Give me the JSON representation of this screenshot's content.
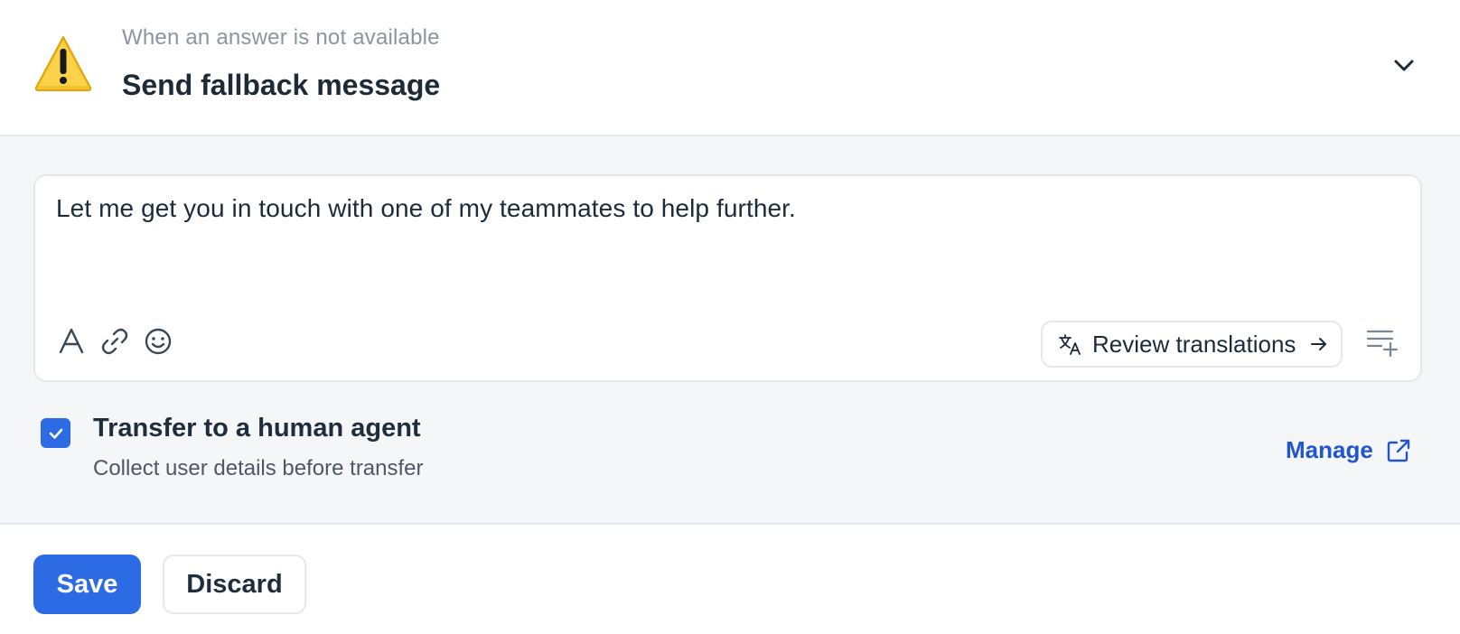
{
  "header": {
    "subtitle": "When an answer is not available",
    "title": "Send fallback message",
    "icon": "warning-icon",
    "toggle_icon": "chevron-down-icon"
  },
  "editor": {
    "value": "Let me get you in touch with one of my teammates to help further.",
    "tools": [
      "text-format-icon",
      "link-icon",
      "emoji-icon"
    ],
    "review_translations_label": "Review translations",
    "insert_icon": "insert-list-icon"
  },
  "transfer": {
    "checked": true,
    "title": "Transfer to a human agent",
    "description": "Collect user details before transfer",
    "manage_label": "Manage"
  },
  "footer": {
    "save_label": "Save",
    "discard_label": "Discard"
  },
  "colors": {
    "accent": "#2d6be4",
    "link": "#1f56cf",
    "panel_bg": "#f5f6f8",
    "warning": "#f5b917"
  }
}
